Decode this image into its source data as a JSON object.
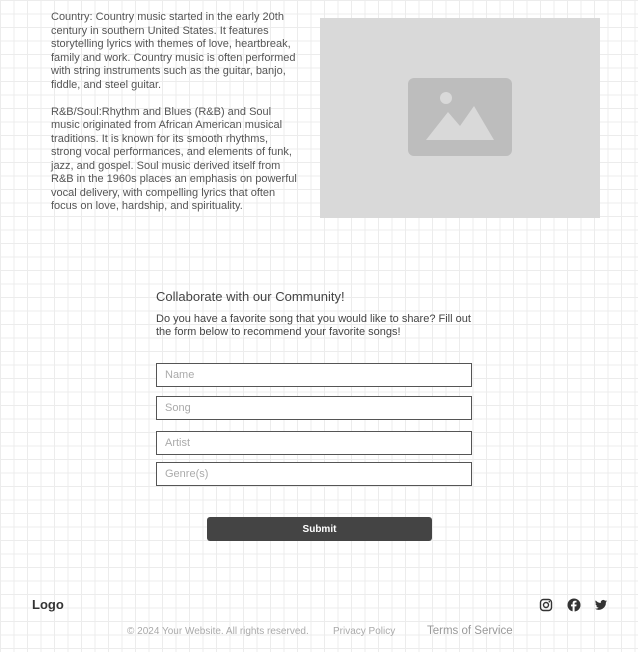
{
  "content": {
    "country": "Country: Country music started in the early 20th century in southern United States. It features storytelling lyrics with themes of love, heartbreak, family and work. Country music is often performed with string instruments such as the guitar, banjo, fiddle, and steel guitar.",
    "rnb": "R&B/Soul:Rhythm and Blues (R&B) and Soul music originated from African American musical traditions. It is known for its smooth rhythms, strong vocal performances, and elements of funk, jazz, and gospel. Soul music derived itself from R&B in the 1960s places an emphasis on powerful vocal delivery, with compelling lyrics that often focus on love, hardship, and spirituality.",
    "image_icon": "image-placeholder-icon"
  },
  "form": {
    "title": "Collaborate with our Community!",
    "description": "Do you have a favorite song that you would like to share? Fill out the form below to recommend your favorite songs!",
    "name_placeholder": "Name",
    "song_placeholder": "Song",
    "artist_placeholder": "Artist",
    "genre_placeholder": "Genre(s)",
    "submit": "Submit"
  },
  "footer": {
    "logo": "Logo",
    "copyright": "© 2024 Your Website. All rights reserved.",
    "privacy": "Privacy Policy",
    "terms": "Terms of Service",
    "icons": [
      "instagram-icon",
      "facebook-icon",
      "twitter-icon"
    ]
  }
}
